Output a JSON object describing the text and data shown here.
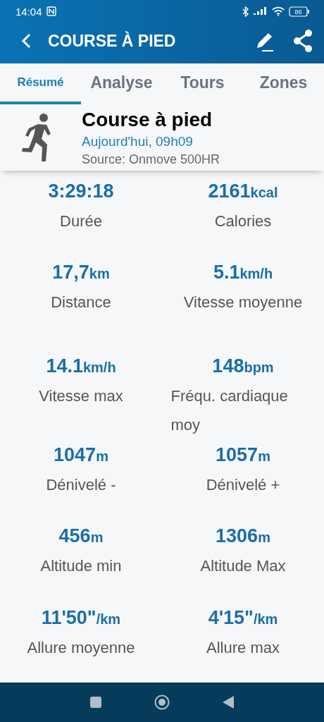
{
  "status_bar": {
    "time": "14:04",
    "battery": "86"
  },
  "app_bar": {
    "title": "COURSE À PIED"
  },
  "tabs": [
    {
      "label": "Résumé",
      "selected": true
    },
    {
      "label": "Analyse",
      "selected": false
    },
    {
      "label": "Tours",
      "selected": false
    },
    {
      "label": "Zones",
      "selected": false
    }
  ],
  "activity": {
    "title": "Course à pied",
    "date": "Aujourd'hui, 09h09",
    "source": "Source: Onmove 500HR"
  },
  "stats": [
    {
      "value": "3:29:18",
      "label": "Durée"
    },
    {
      "value": "2161",
      "unit": "kcal",
      "label": "Calories"
    },
    {
      "value": "17,7",
      "unit": "km",
      "label": "Distance"
    },
    {
      "value": "5.1",
      "unit": "km/h",
      "label": "Vitesse moyenne"
    },
    {
      "value": "14.1",
      "unit": "km/h",
      "label": "Vitesse max"
    },
    {
      "value": "148",
      "unit": "bpm",
      "label": "Fréqu. cardiaque moy"
    },
    {
      "value": "1047",
      "unit": "m",
      "label": "Dénivelé -"
    },
    {
      "value": "1057",
      "unit": "m",
      "label": "Dénivelé +"
    },
    {
      "value": "456",
      "unit": "m",
      "label": "Altitude min"
    },
    {
      "value": "1306",
      "unit": "m",
      "label": "Altitude Max"
    },
    {
      "value": "11'50\"",
      "unit": "/km",
      "label": "Allure moyenne"
    },
    {
      "value": "4'15\"",
      "unit": "/km",
      "label": "Allure max"
    }
  ]
}
